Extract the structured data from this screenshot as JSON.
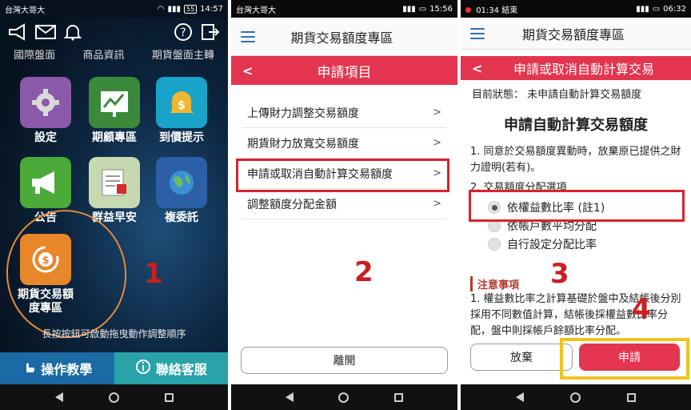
{
  "screen1": {
    "status": {
      "carrier": "台灣大哥大",
      "battery": "55",
      "time": "14:57"
    },
    "clipped_labels": [
      "國際盤面",
      "商品資訊",
      "期貨盤面主轉"
    ],
    "apps": [
      {
        "label": "設定",
        "icon": "gear-icon",
        "color": "#8a5aa8"
      },
      {
        "label": "期顧專區",
        "icon": "chart-board-icon",
        "color": "#3b8a3b"
      },
      {
        "label": "到價提示",
        "icon": "bell-dollar-icon",
        "color": "#1aa3c8"
      },
      {
        "label": "公告",
        "icon": "megaphone-icon",
        "color": "#4caa38"
      },
      {
        "label": "群益早安",
        "icon": "newspaper-icon",
        "color": "#c7d9b0"
      },
      {
        "label": "複委託",
        "icon": "globe-icon",
        "color": "#2b5fa6"
      },
      {
        "label": "期貨交易額度專區",
        "icon": "dollar-coin-icon",
        "color": "#e8862a"
      }
    ],
    "hint": "長按按鈕可啟動拖曳動作調整順序",
    "tutorial": "操作教學",
    "service": "聯絡客服",
    "annotation": "1"
  },
  "screen2": {
    "status": {
      "carrier": "台灣大哥大",
      "time": "15:56"
    },
    "title": "期貨交易額度專區",
    "section": "申請項目",
    "items": [
      "上傳財力調整交易額度",
      "期貨財力放寬交易額度",
      "申請或取消自動計算交易額度",
      "調整額度分配金額"
    ],
    "close": "離開",
    "annotation": "2"
  },
  "screen3": {
    "status": {
      "time_left": "01:34",
      "call": "結束",
      "time": "06:32"
    },
    "title": "期貨交易額度專區",
    "section": "申請或取消自動計算交易",
    "current_status": "目前狀態：  未申請自動計算交易額度",
    "heading": "申請自動計算交易額度",
    "clause1": "1. 同意於交易額度異動時，放棄原已提供之財力證明(若有)。",
    "clause2": "2. 交易額度分配選項",
    "options": [
      "依權益數比率 (註1)",
      "依帳戶數平均分配",
      "自行設定分配比率"
    ],
    "selected_option": 0,
    "note_title": "注意事項",
    "note1": "1. 權益數比率之計算基礎於盤中及結帳後分別採用不同數值計算，結帳後採權益數比率分配，盤中則採帳戶餘額比率分配。",
    "cancel": "放棄",
    "apply": "申請",
    "annotation3": "3",
    "annotation4": "4"
  }
}
